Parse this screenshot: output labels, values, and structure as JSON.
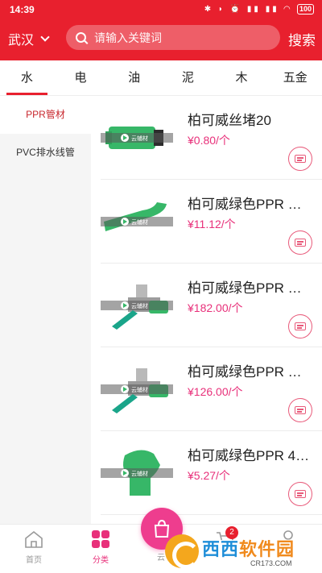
{
  "status_bar": {
    "time": "14:39",
    "icons_text": "✱ ◗ ⏰ ▮▮ ▮▮ ◠",
    "battery": "100"
  },
  "header": {
    "city": "武汉",
    "search_placeholder": "请输入关键词",
    "search_button": "搜索"
  },
  "tabs": [
    {
      "label": "水",
      "active": true
    },
    {
      "label": "电",
      "active": false
    },
    {
      "label": "油",
      "active": false
    },
    {
      "label": "泥",
      "active": false
    },
    {
      "label": "木",
      "active": false
    },
    {
      "label": "五金",
      "active": false
    }
  ],
  "sidenav": [
    {
      "label": "PPR管材",
      "active": true
    },
    {
      "label": "PVC排水线管",
      "active": false
    }
  ],
  "products": [
    {
      "name": "柏可威丝堵20",
      "price": "¥0.80/个",
      "image": "plug-fitting",
      "badge_text": "云辅材"
    },
    {
      "name": "柏可威绿色PPR …",
      "price": "¥11.12/个",
      "image": "elbow-fitting",
      "badge_text": "云辅材"
    },
    {
      "name": "柏可威绿色PPR …",
      "price": "¥182.00/个",
      "image": "valve-fitting",
      "badge_text": "云辅材"
    },
    {
      "name": "柏可威绿色PPR …",
      "price": "¥126.00/个",
      "image": "valve-fitting",
      "badge_text": "云辅材"
    },
    {
      "name": "柏可威绿色PPR 4…",
      "price": "¥5.27/个",
      "image": "45-elbow-fitting",
      "badge_text": "云辅材"
    }
  ],
  "bottom_nav": [
    {
      "label": "首页",
      "icon": "home-icon",
      "active": false
    },
    {
      "label": "分类",
      "icon": "grid-icon",
      "active": true
    },
    {
      "label": "云",
      "icon": "bag-icon",
      "active": false
    },
    {
      "label": "",
      "icon": "cart-icon",
      "active": false
    },
    {
      "label": "",
      "icon": "user-icon",
      "active": false
    }
  ],
  "cart_badge": "2",
  "watermark": {
    "text_a": "西西",
    "text_b": "软件园",
    "url": "CR173.COM"
  },
  "colors": {
    "brand_red": "#e8202e",
    "price_pink": "#e8307a",
    "fab_pink": "#ee3d8e",
    "pipe_green": "#2fae5f"
  }
}
